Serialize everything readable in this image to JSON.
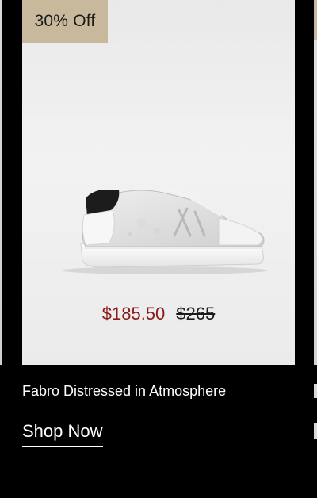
{
  "product": {
    "badge": "30% Off",
    "image_icon": "sneaker-image",
    "sale_price": "$185.50",
    "original_price": "$265",
    "name": "Fabro Distressed in Atmosphere",
    "cta_label": "Shop Now"
  },
  "colors": {
    "background": "#000000",
    "badge_background": "#c9b99c",
    "sale_price": "#8b1a1a",
    "card_background": "#eeeeee"
  }
}
